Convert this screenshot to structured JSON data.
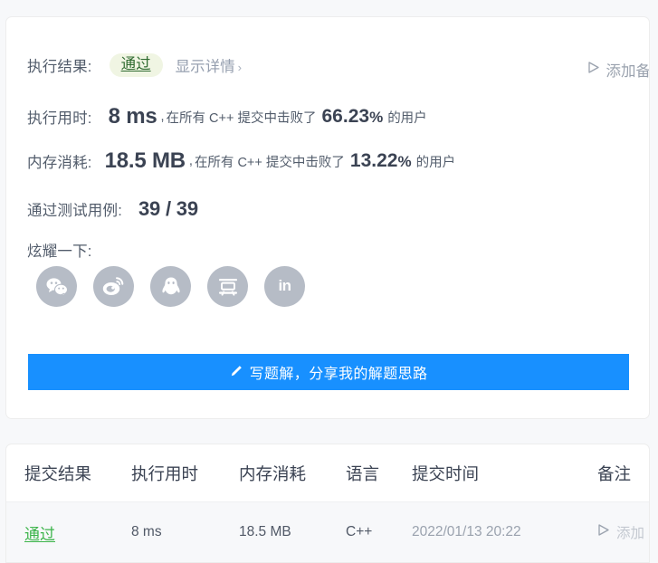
{
  "result_card": {
    "result_label": "执行结果:",
    "result_badge": "通过",
    "detail_link": "显示详情",
    "detail_chevron": "›",
    "add_note_top": "添加备",
    "time_label": "执行用时:",
    "time_value": "8 ms",
    "time_comma": ",",
    "time_prefix": "在所有 C++ 提交中击败了",
    "time_percent": "66.23",
    "percent_symbol": "%",
    "time_suffix": "的用户",
    "memory_label": "内存消耗:",
    "memory_value": "18.5 MB",
    "memory_comma": ",",
    "memory_prefix": "在所有 C++ 提交中击败了",
    "memory_percent": "13.22",
    "memory_suffix": "的用户",
    "cases_label": "通过测试用例:",
    "cases_value": "39 / 39",
    "share_label": "炫耀一下:",
    "socials": [
      {
        "name": "wechat-icon"
      },
      {
        "name": "weibo-icon"
      },
      {
        "name": "qq-icon"
      },
      {
        "name": "douban-icon"
      },
      {
        "name": "linkedin-icon",
        "text": "in"
      }
    ],
    "write_button": "写题解，分享我的解题思路"
  },
  "submissions_table": {
    "columns": [
      "提交结果",
      "执行用时",
      "内存消耗",
      "语言",
      "提交时间",
      "备注"
    ],
    "rows": [
      {
        "result": "通过",
        "runtime": "8 ms",
        "memory": "18.5 MB",
        "language": "C++",
        "time": "2022/01/13 20:22",
        "note": "添加"
      }
    ]
  },
  "colors": {
    "accent": "#1890ff",
    "pass_green": "#3cb44a",
    "badge_bg": "#f0f5e3",
    "badge_text": "#2f6b30",
    "page_bg": "#f7f8fa"
  }
}
